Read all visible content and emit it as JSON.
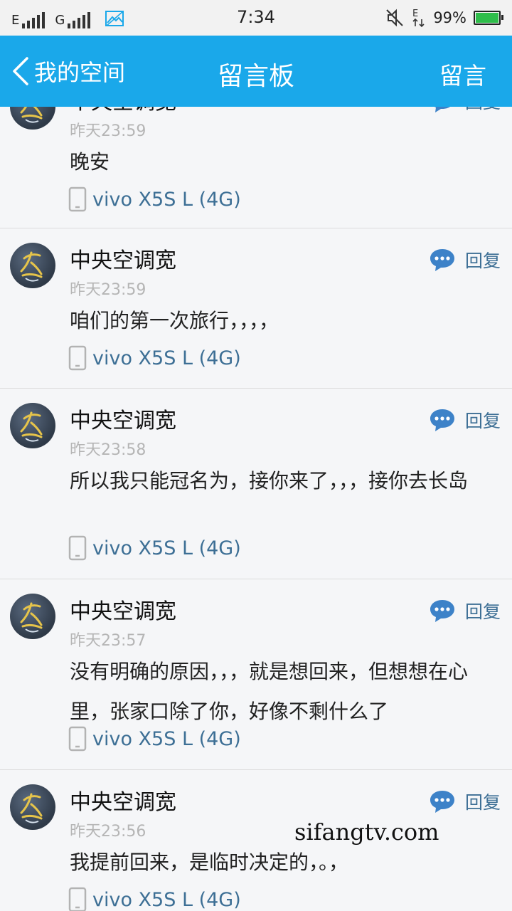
{
  "status_bar": {
    "network_1": "E",
    "network_2": "G",
    "time": "7:34",
    "battery": "99%",
    "battery_level": 0.99,
    "icons": [
      "signal-icon",
      "signal-icon",
      "image-icon",
      "mute-icon",
      "data-transfer-icon",
      "battery-icon"
    ]
  },
  "header": {
    "back_label": "我的空间",
    "title": "留言板",
    "action_label": "留言"
  },
  "reply_label": "回复",
  "colors": {
    "header_bg": "#1aa8ea",
    "link": "#3d6f95",
    "reply_icon": "#3d82c8",
    "battery_fill": "#2ebd4a"
  },
  "messages": [
    {
      "name": "中央空调宽",
      "time": "昨天23:59",
      "text": "晚安",
      "device": "vivo X5S L (4G)"
    },
    {
      "name": "中央空调宽",
      "time": "昨天23:59",
      "text": "咱们的第一次旅行，，，，",
      "device": "vivo X5S L (4G)"
    },
    {
      "name": "中央空调宽",
      "time": "昨天23:58",
      "text": "所以我只能冠名为，接你来了，，，接你去长岛",
      "device": "vivo X5S L (4G)"
    },
    {
      "name": "中央空调宽",
      "time": "昨天23:57",
      "text": "没有明确的原因，，，就是想回来，但想想在心里，张家口除了你，好像不剩什么了",
      "device": "vivo X5S L (4G)"
    },
    {
      "name": "中央空调宽",
      "time": "昨天23:56",
      "text": "我提前回来，是临时决定的，。，",
      "device": "vivo X5S L (4G)"
    }
  ],
  "watermark": "sifangtv.com"
}
